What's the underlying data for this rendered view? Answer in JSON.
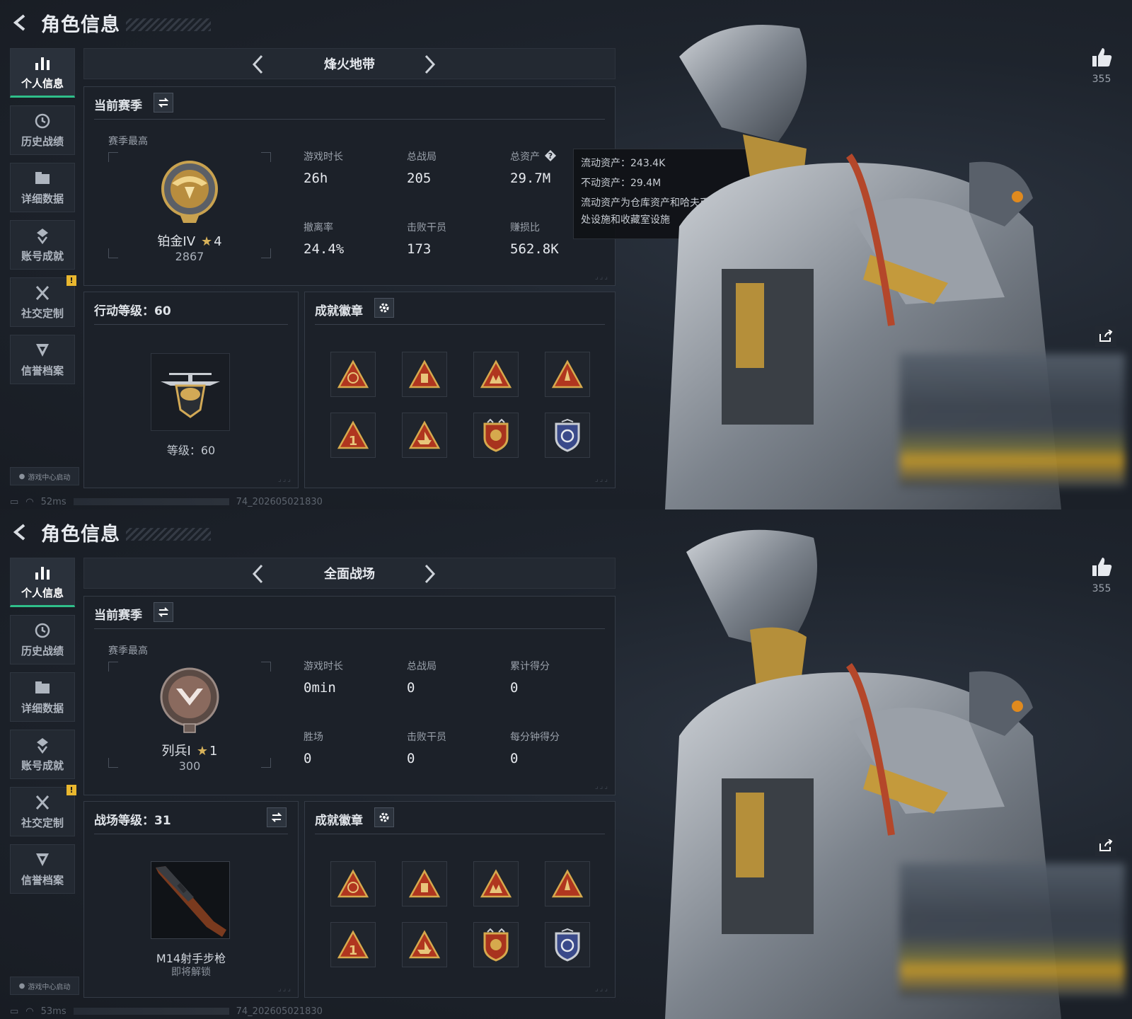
{
  "screens": [
    {
      "title": "角色信息",
      "nav": [
        {
          "label": "个人信息",
          "icon": "bar-chart-icon"
        },
        {
          "label": "历史战绩",
          "icon": "clock-icon"
        },
        {
          "label": "详细数据",
          "icon": "folder-icon"
        },
        {
          "label": "账号成就",
          "icon": "achievement-icon"
        },
        {
          "label": "社交定制",
          "icon": "tools-icon",
          "badge": "!"
        },
        {
          "label": "信誉档案",
          "icon": "shield-icon"
        }
      ],
      "launch_chip": "游戏中心启动",
      "status": {
        "ping": "52ms",
        "build": "74_202605021830"
      },
      "mode": "烽火地带",
      "season": {
        "title": "当前赛季",
        "best_label": "赛季最高",
        "rank_name": "铂金IV",
        "rank_stars": "4",
        "rank_score": "2867",
        "stats": [
          {
            "label": "游戏时长",
            "value": "26h"
          },
          {
            "label": "总战局",
            "value": "205"
          },
          {
            "label": "总资产",
            "value": "29.7M",
            "help": true
          },
          {
            "label": "撤离率",
            "value": "24.4%"
          },
          {
            "label": "击败干员",
            "value": "173"
          },
          {
            "label": "赚损比",
            "value": "562.8K"
          }
        ]
      },
      "tooltip": {
        "line1": "流动资产：243.4K",
        "line2": "不动资产：29.4M",
        "desc": "流动资产为仓库资产和哈夫币，不动资产为特勤处设施和收藏室设施"
      },
      "level": {
        "title": "行动等级：60",
        "caption": "等级：60"
      },
      "badges": {
        "title": "成就徽章"
      },
      "likes": "355"
    },
    {
      "title": "角色信息",
      "nav": [
        {
          "label": "个人信息",
          "icon": "bar-chart-icon"
        },
        {
          "label": "历史战绩",
          "icon": "clock-icon"
        },
        {
          "label": "详细数据",
          "icon": "folder-icon"
        },
        {
          "label": "账号成就",
          "icon": "achievement-icon"
        },
        {
          "label": "社交定制",
          "icon": "tools-icon",
          "badge": "!"
        },
        {
          "label": "信誉档案",
          "icon": "shield-icon"
        }
      ],
      "launch_chip": "游戏中心启动",
      "status": {
        "ping": "53ms",
        "build": "74_202605021830"
      },
      "mode": "全面战场",
      "season": {
        "title": "当前赛季",
        "best_label": "赛季最高",
        "rank_name": "列兵Ⅰ",
        "rank_stars": "1",
        "rank_score": "300",
        "stats": [
          {
            "label": "游戏时长",
            "value": "0min"
          },
          {
            "label": "总战局",
            "value": "0"
          },
          {
            "label": "累计得分",
            "value": "0"
          },
          {
            "label": "胜场",
            "value": "0"
          },
          {
            "label": "击败干员",
            "value": "0"
          },
          {
            "label": "每分钟得分",
            "value": "0"
          }
        ]
      },
      "level": {
        "title": "战场等级：31",
        "weapon_name": "M14射手步枪",
        "weapon_sub": "即将解锁"
      },
      "badges": {
        "title": "成就徽章"
      },
      "likes": "355"
    }
  ],
  "colors": {
    "accent_green": "#2fbf8a",
    "gold": "#d7b25a",
    "warning_badge": "#e9b72f"
  }
}
